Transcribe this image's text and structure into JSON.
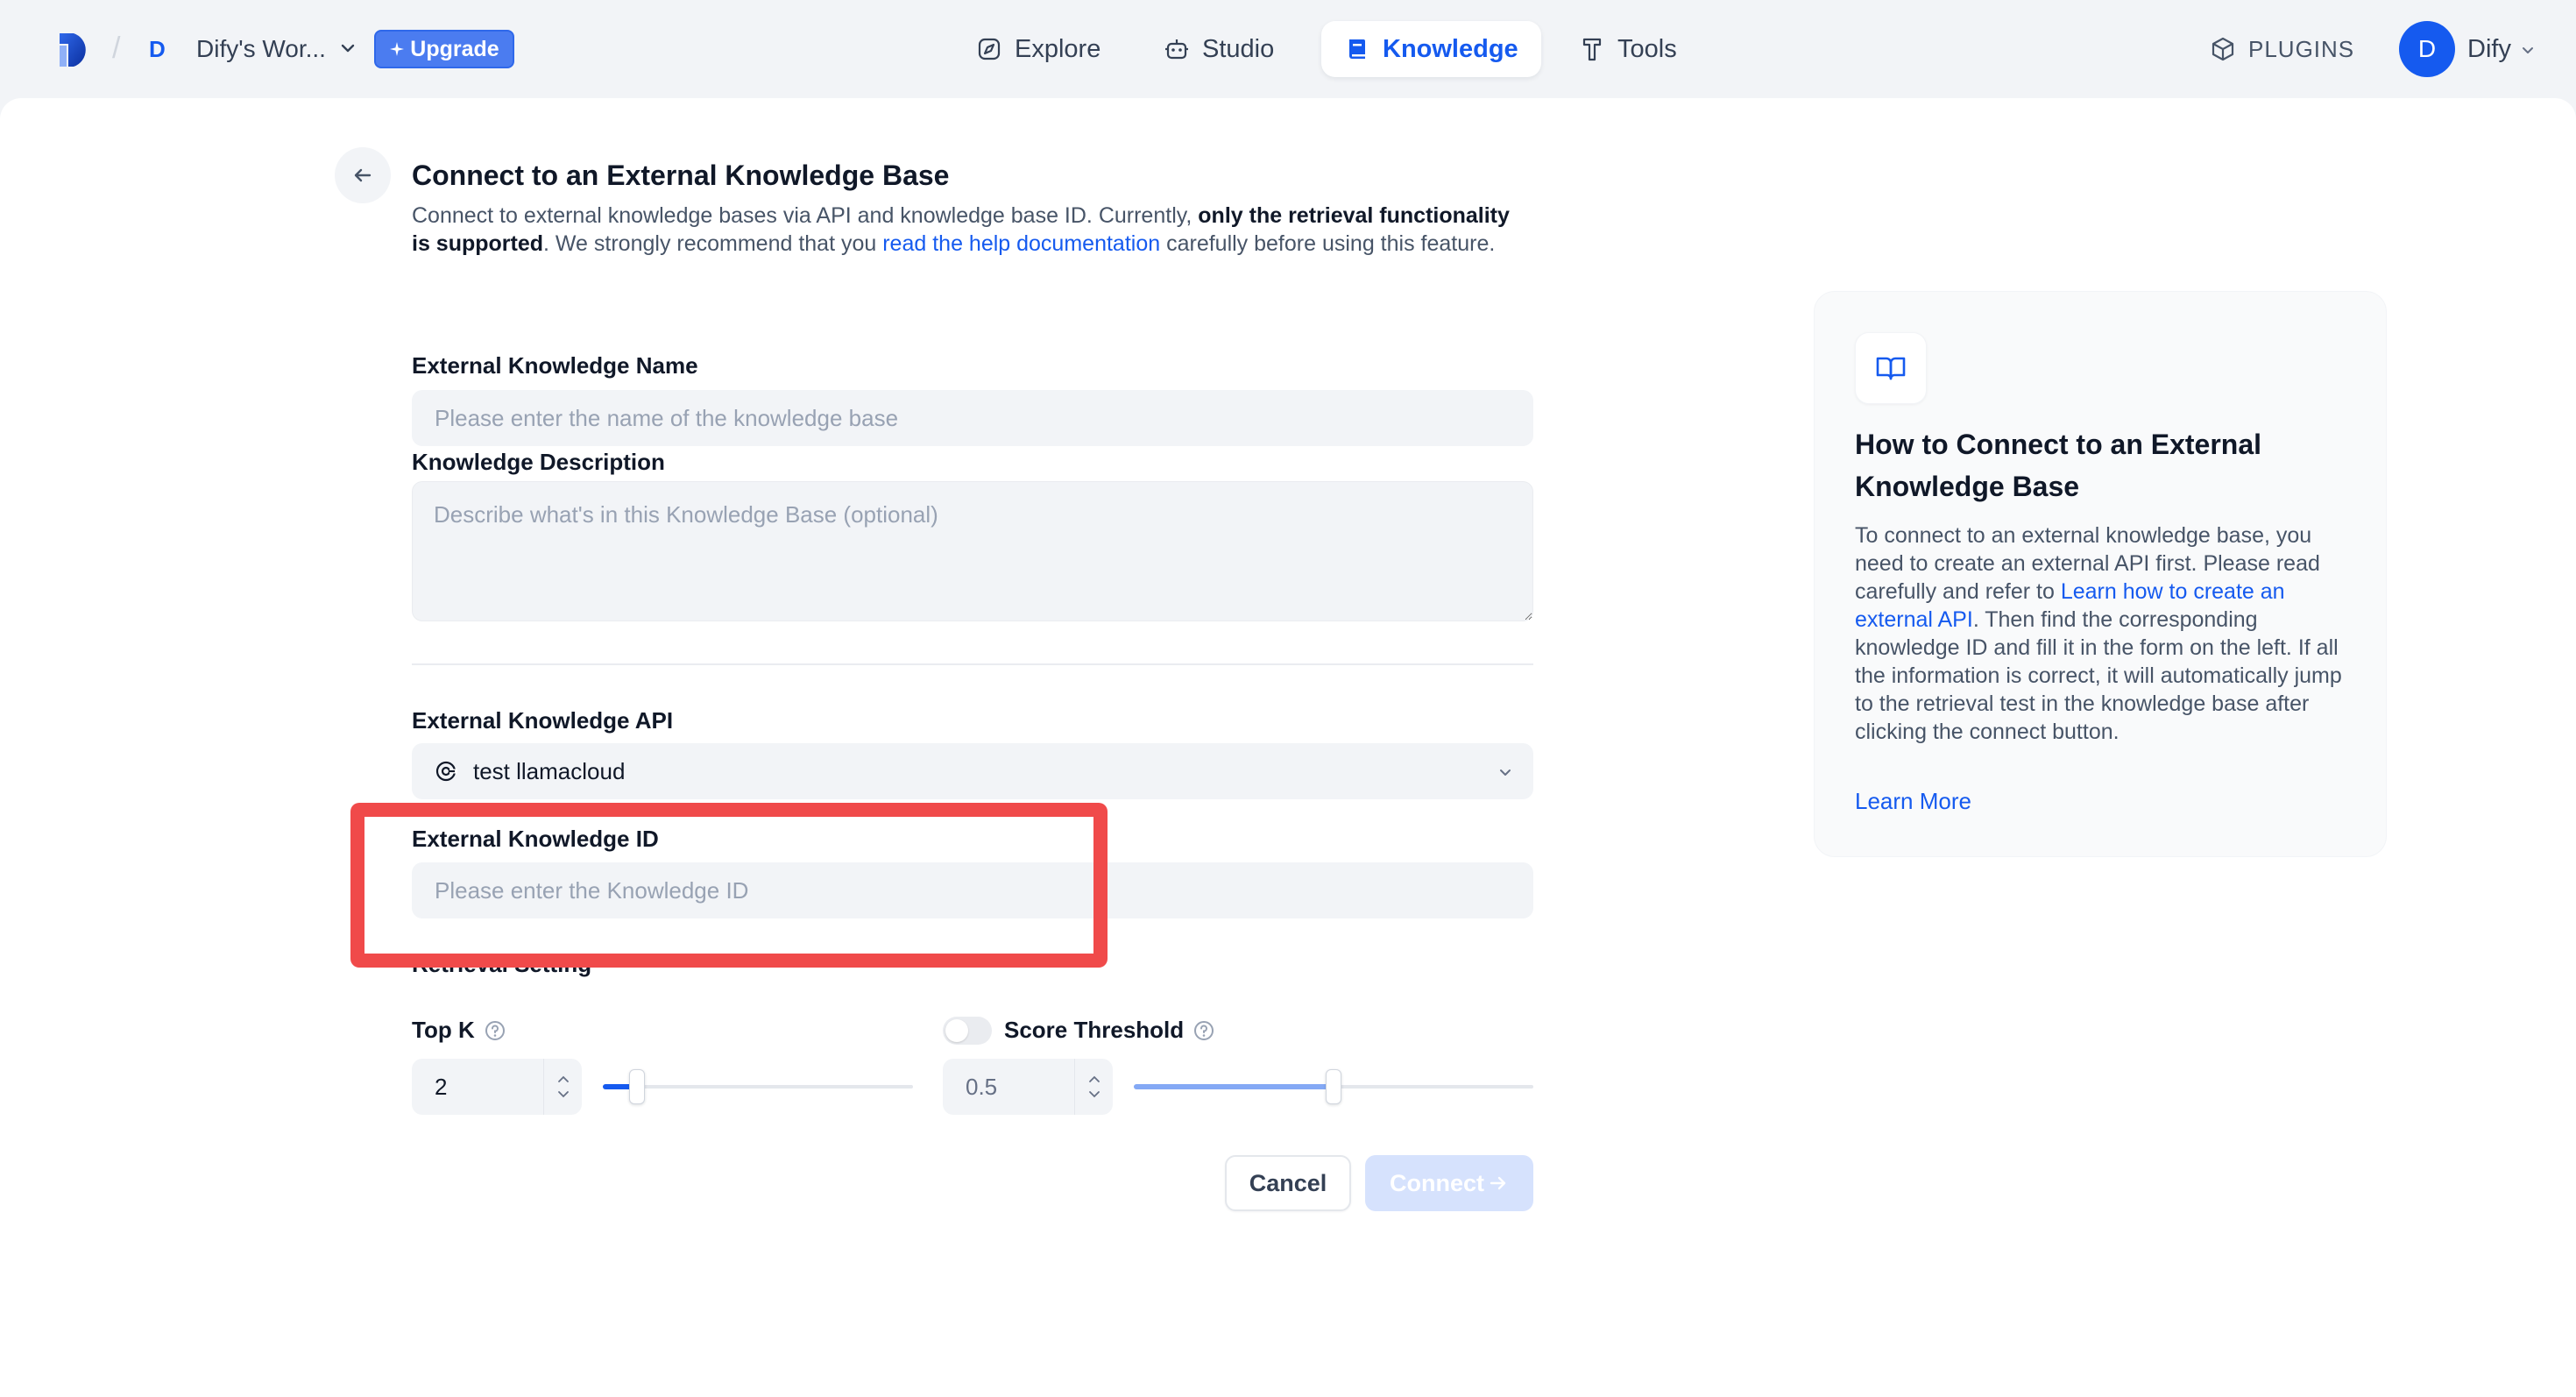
{
  "header": {
    "workspace_initial": "D",
    "workspace_name": "Dify's Wor...",
    "upgrade_label": "Upgrade",
    "nav": [
      {
        "label": "Explore",
        "icon": "compass-icon"
      },
      {
        "label": "Studio",
        "icon": "robot-icon"
      },
      {
        "label": "Knowledge",
        "icon": "book-icon",
        "active": true
      },
      {
        "label": "Tools",
        "icon": "hammer-icon"
      }
    ],
    "plugins_label": "PLUGINS",
    "user_initial": "D",
    "user_name": "Dify"
  },
  "form": {
    "title": "Connect to an External Knowledge Base",
    "desc_part1": "Connect to external knowledge bases via API and knowledge base ID. Currently, ",
    "desc_bold": "only the retrieval functionality is supported",
    "desc_part2": ". We strongly recommend that you ",
    "desc_link": "read the help documentation",
    "desc_part3": " carefully before using this feature.",
    "name_label": "External Knowledge Name",
    "name_placeholder": "Please enter the name of the knowledge base",
    "description_label": "Knowledge Description",
    "description_placeholder": "Describe what's in this Knowledge Base (optional)",
    "api_label": "External Knowledge API",
    "api_value": "test llamacloud",
    "id_label": "External Knowledge ID",
    "id_placeholder": "Please enter the Knowledge ID",
    "retrieval_label": "Retrieval Setting",
    "topk_label": "Top K",
    "topk_value": "2",
    "topk_range": [
      1,
      10
    ],
    "score_label": "Score Threshold",
    "score_value": "0.5",
    "score_enabled": false,
    "cancel_label": "Cancel",
    "connect_label": "Connect"
  },
  "panel": {
    "title": "How to Connect to an External Knowledge Base",
    "body_part1": "To connect to an external knowledge base, you need to create an external API first. Please read carefully and refer to ",
    "body_link": "Learn how to create an external API",
    "body_part2": ". Then find the corresponding knowledge ID and fill it in the form on the left. If all the information is correct, it will automatically jump to the retrieval test in the knowledge base after clicking the connect button.",
    "learn_more": "Learn More"
  },
  "colors": {
    "accent": "#155aef",
    "highlight": "#f04a4a",
    "background": "#f2f4f7"
  }
}
